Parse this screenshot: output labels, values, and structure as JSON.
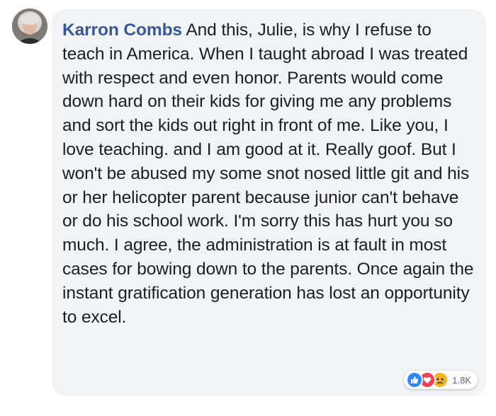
{
  "comment": {
    "author": "Karron Combs",
    "text": "And this, Julie, is why I refuse to teach in America. When I taught abroad I was treated with respect and even honor. Parents would come down hard on their kids for giving me any problems and sort the kids out right in front of me. Like you, I love teaching. and I am good at it. Really goof. But I won't be abused my some snot nosed little git and his or her helicopter parent because junior can't behave or do his school work. I'm sorry this has hurt you so much. I agree, the administration is at fault in most cases for bowing down to the parents. Once again the instant gratification generation has lost an opportunity to excel.",
    "reactions": {
      "icons": [
        "like-icon",
        "love-icon",
        "sad-icon"
      ],
      "count": "1.8K"
    }
  },
  "colors": {
    "author": "#385898",
    "bubble": "#f2f3f5",
    "text": "#1c1e21",
    "like": "#2d88ff",
    "love": "#f33e58",
    "sad": "#f7b125"
  }
}
